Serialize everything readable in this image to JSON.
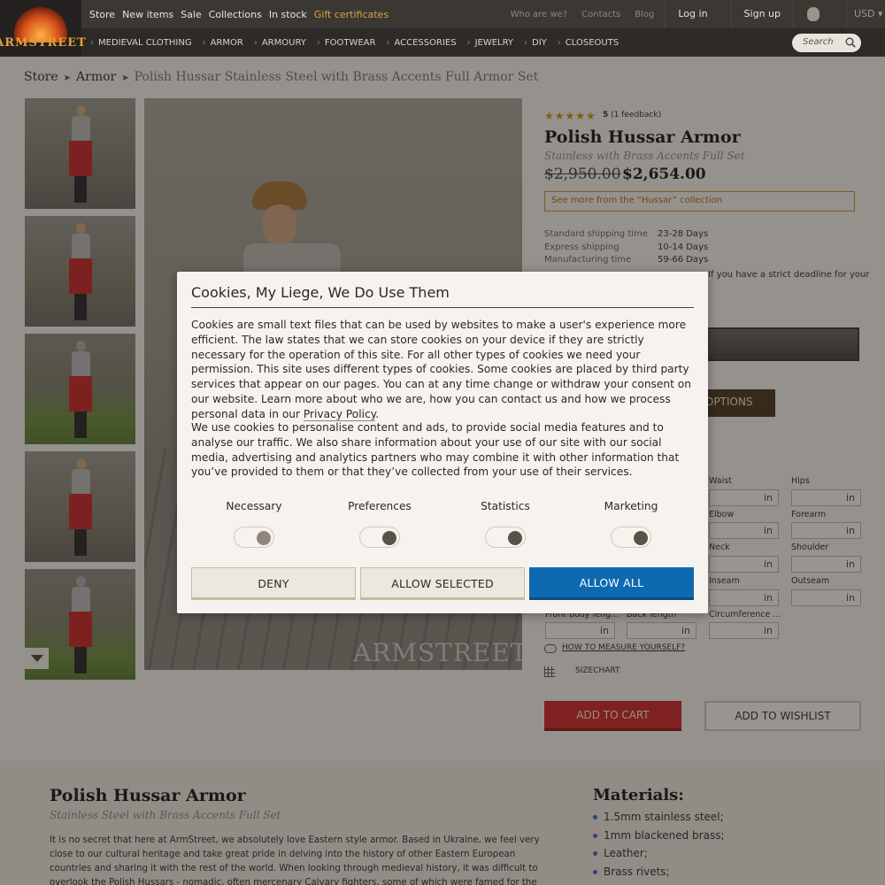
{
  "logo": {
    "text": "ARMSTREET"
  },
  "topnav": {
    "links": [
      "Store",
      "New items",
      "Sale",
      "Collections",
      "In stock"
    ],
    "gift": "Gift certificates",
    "secondary": [
      "Who are we?",
      "Contacts",
      "Blog"
    ],
    "login": "Log in",
    "signup": "Sign up",
    "currency": "USD"
  },
  "catnav": {
    "items": [
      "MEDIEVAL CLOTHING",
      "ARMOR",
      "ARMOURY",
      "FOOTWEAR",
      "ACCESSORIES",
      "JEWELRY",
      "DIY",
      "CLOSEOUTS"
    ],
    "search_placeholder": "Search"
  },
  "breadcrumb": [
    "Store",
    "Armor",
    "Polish Hussar Stainless Steel with Brass Accents Full Armor Set"
  ],
  "gallery": {
    "watermark": "ARMSTREET"
  },
  "product": {
    "stars": "★★★★★",
    "rating": "5",
    "feedback": "(1 feedback)",
    "title": "Polish Hussar Armor",
    "subtitle": "Stainless with Brass Accents Full Set",
    "old_price": "$2,950.00",
    "new_price": "$2,654.00",
    "collection_link": "See more from the “Hussar” collection",
    "shipping": [
      {
        "label": "Standard shipping time",
        "value": "23-28 Days"
      },
      {
        "label": "Express shipping",
        "value": "10-14 Days"
      },
      {
        "label": "Manufacturing time",
        "value": "59-66 Days"
      }
    ],
    "deadline_fragment": "If you have a strict deadline for your",
    "options_fragment": "OPTIONS",
    "measurements": [
      {
        "label": "Waist",
        "unit": "in"
      },
      {
        "label": "Hips",
        "unit": "in"
      },
      {
        "label": "Elbow",
        "unit": "in"
      },
      {
        "label": "Forearm",
        "unit": "in"
      },
      {
        "label": "Neck",
        "unit": "in"
      },
      {
        "label": "Shoulder",
        "unit": "in"
      },
      {
        "label": "Inseam",
        "unit": "in"
      },
      {
        "label": "Outseam",
        "unit": "in"
      },
      {
        "label": "Front body leng...",
        "unit": "in"
      },
      {
        "label": "Back length",
        "unit": "in"
      },
      {
        "label": "Circumference ...",
        "unit": "in"
      }
    ],
    "how_to_measure": "HOW TO MEASURE YOURSELF?",
    "sizechart": "SIZECHART",
    "add_to_cart": "ADD TO CART",
    "add_to_wishlist": "ADD TO WISHLIST"
  },
  "description": {
    "title": "Polish Hussar Armor",
    "subtitle": "Stainless Steel with Brass Accents Full Set",
    "text": "It is no secret that here at ArmStreet, we absolutely love Eastern style armor. Based in Ukraine, we feel very close to our cultural heritage and take great pride in delving into the history of other Eastern European countries and sharing it with the rest of the world. When looking through medieval history, it was difficult to overlook the Polish Hussars - nomadic, often mercenary Calvary fighters, some of which were famed for the wooden frames they would wear on",
    "materials_title": "Materials:",
    "materials": [
      "1.5mm stainless steel;",
      "1mm blackened brass;",
      "Leather;",
      "Brass rivets;"
    ]
  },
  "cookie": {
    "title": "Cookies, My Liege, We Do Use Them",
    "p1_before": "Cookies are small text files that can be used by websites to make a user's experience more efficient. The law states that we can store cookies on your device if they are strictly necessary for the operation of this site. For all other types of cookies we need your permission. This site uses different types of cookies. Some cookies are placed by third party services that appear on our pages. You can at any time change or withdraw your consent on our website. Learn more about who we are, how you can contact us and how we process personal data in our",
    "privacy_link": "Privacy Policy",
    "p1_after": ".",
    "p2": "We use cookies to personalise content and ads, to provide social media features and to analyse our traffic. We also share information about your use of our site with our social media, advertising and analytics partners who may combine it with other information that you’ve provided to them or that they’ve collected from your use of their services.",
    "categories": [
      {
        "label": "Necessary",
        "checked": true,
        "disabled": true
      },
      {
        "label": "Preferences",
        "checked": true
      },
      {
        "label": "Statistics",
        "checked": true
      },
      {
        "label": "Marketing",
        "checked": true
      }
    ],
    "deny": "DENY",
    "allow_selected": "ALLOW SELECTED",
    "allow_all": "ALLOW ALL"
  },
  "colors": {
    "accent_blue": "#0e6ab0",
    "cart_red": "#c82a2a",
    "gift_gold": "#d9a23a"
  }
}
